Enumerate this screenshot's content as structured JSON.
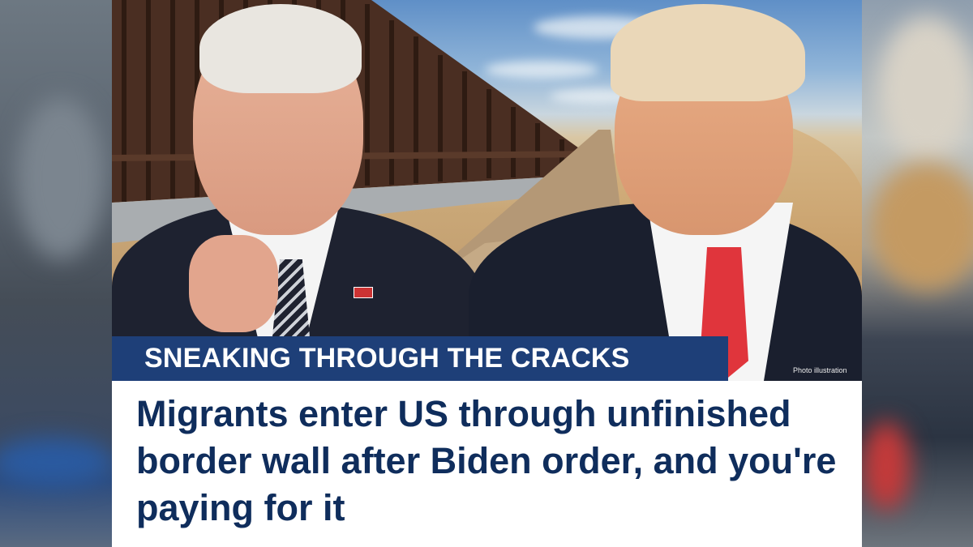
{
  "banner": {
    "text": "SNEAKING THROUGH THE CRACKS"
  },
  "photo": {
    "credit": "Photo illustration"
  },
  "headline": {
    "text": "Migrants enter US through unfinished border wall after Biden order, and you're paying for it"
  },
  "colors": {
    "banner_bg": "#1e3f78",
    "headline_text": "#0f2d5c",
    "tie_red": "#e0353c"
  }
}
